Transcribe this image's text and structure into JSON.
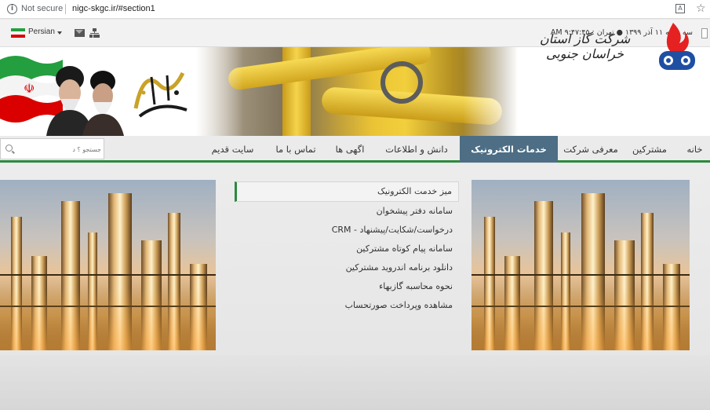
{
  "browser": {
    "security_label": "Not secure",
    "url": "nigc-skgc.ir/#section1"
  },
  "topbar": {
    "language": "Persian",
    "datetime": "سه شنبه ۱۱ آذر ۱۳۹۹ ● تهران : ۹:۴۷:۴۵ AM"
  },
  "banner": {
    "company_name": "شرکت گاز استان خراسان جنوبی"
  },
  "nav": {
    "items": [
      {
        "label": "خانه"
      },
      {
        "label": "مشترکین"
      },
      {
        "label": "معرفی شرکت"
      },
      {
        "label": "خدمات الکترونیک"
      },
      {
        "label": "دانش و اطلاعات"
      },
      {
        "label": "اگهی ها"
      },
      {
        "label": "تماس با ما"
      },
      {
        "label": "سایت قدیم"
      }
    ],
    "active_index": 3,
    "search_placeholder": "جستجو ؟ د"
  },
  "services_menu": {
    "items": [
      {
        "label": "میز خدمت الکترونیک"
      },
      {
        "label": "سامانه دفتر پیشخوان"
      },
      {
        "label": "درخواست/شکایت/پیشنهاد - CRM"
      },
      {
        "label": "سامانه پیام کوتاه مشترکین"
      },
      {
        "label": "دانلود برنامه اندروید مشترکین"
      },
      {
        "label": "نحوه محاسبه گازبهاء"
      },
      {
        "label": "مشاهده وپرداخت صورتحساب"
      }
    ]
  },
  "colors": {
    "accent_green": "#2d8a3e",
    "active_tab": "#4d6e84"
  },
  "icons": [
    "info-icon",
    "translate-icon",
    "star-icon",
    "mail-icon",
    "sitemap-icon",
    "search-icon",
    "nigc-flame-logo"
  ]
}
